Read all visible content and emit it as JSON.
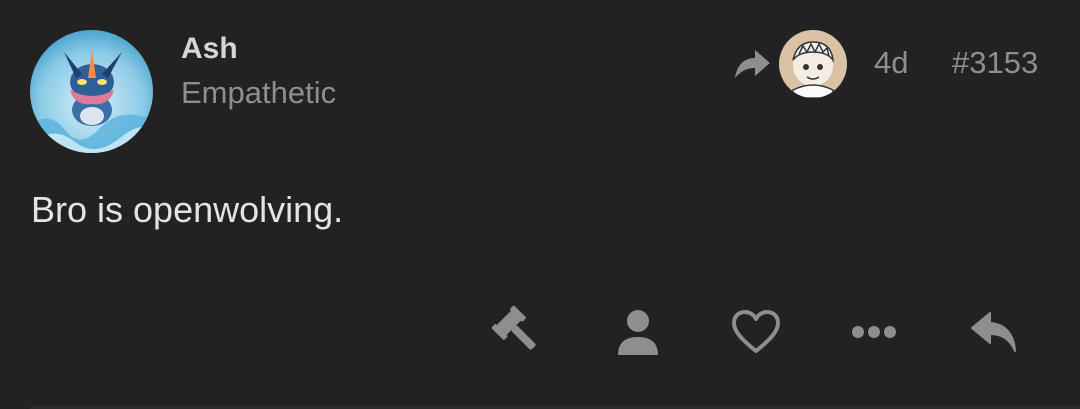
{
  "post": {
    "author": {
      "name": "Ash",
      "title": "Empathetic",
      "avatar_icon": "greninja-avatar-icon"
    },
    "reply_to": {
      "icon": "reply-arrow-icon",
      "avatar_icon": "reply-user-avatar-icon"
    },
    "age": "4d",
    "number": "#3153",
    "body": "Bro is openwolving.",
    "actions": [
      {
        "name": "moderate",
        "icon": "gavel-icon"
      },
      {
        "name": "user",
        "icon": "user-icon"
      },
      {
        "name": "like",
        "icon": "heart-icon"
      },
      {
        "name": "more",
        "icon": "ellipsis-icon"
      },
      {
        "name": "reply",
        "icon": "reply-icon"
      }
    ]
  },
  "colors": {
    "background": "#222222",
    "primary_text": "#e4e4e4",
    "secondary_text": "#8e8e8e",
    "icon": "#8e8e8e"
  }
}
